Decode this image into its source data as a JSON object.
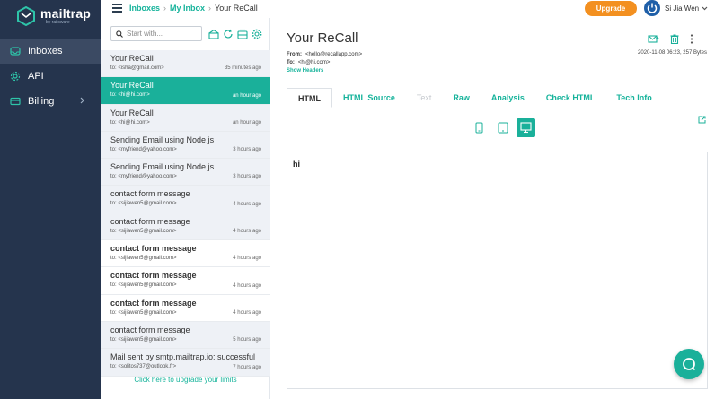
{
  "app": {
    "name": "mailtrap",
    "byline": "by railsware"
  },
  "nav": [
    {
      "label": "Inboxes"
    },
    {
      "label": "API"
    },
    {
      "label": "Billing"
    }
  ],
  "breadcrumb": {
    "level1": "Inboxes",
    "level2": "My Inbox",
    "current": "Your ReCall",
    "separator": "›"
  },
  "header": {
    "upgrade_label": "Upgrade",
    "user_name": "Si Jia Wen"
  },
  "search": {
    "placeholder": "Start with..."
  },
  "messages": [
    {
      "subject": "Your ReCall",
      "to": "to: <isha@gmail.com>",
      "time": "35 minutes ago"
    },
    {
      "subject": "Your ReCall",
      "to": "to: <hi@hi.com>",
      "time": "an hour ago"
    },
    {
      "subject": "Your ReCall",
      "to": "to: <hi@hi.com>",
      "time": "an hour ago"
    },
    {
      "subject": "Sending Email using Node.js",
      "to": "to: <myfriend@yahoo.com>",
      "time": "3 hours ago"
    },
    {
      "subject": "Sending Email using Node.js",
      "to": "to: <myfriend@yahoo.com>",
      "time": "3 hours ago"
    },
    {
      "subject": "contact form message",
      "to": "to: <sijiawen5@gmail.com>",
      "time": "4 hours ago"
    },
    {
      "subject": "contact form message",
      "to": "to: <sijiawen5@gmail.com>",
      "time": "4 hours ago"
    },
    {
      "subject": "contact form message",
      "to": "to: <sijiawen5@gmail.com>",
      "time": "4 hours ago"
    },
    {
      "subject": "contact form message",
      "to": "to: <sijiawen5@gmail.com>",
      "time": "4 hours ago"
    },
    {
      "subject": "contact form message",
      "to": "to: <sijiawen5@gmail.com>",
      "time": "4 hours ago"
    },
    {
      "subject": "contact form message",
      "to": "to: <sijiawen5@gmail.com>",
      "time": "5 hours ago"
    },
    {
      "subject": "Mail sent by smtp.mailtrap.io: successful",
      "to": "to: <solitos737@outlook.fr>",
      "time": "7 hours ago"
    }
  ],
  "upgrade_link": "Click here to upgrade your limits",
  "message": {
    "subject": "Your ReCall",
    "from_label": "From:",
    "from": "<hello@recallapp.com>",
    "to_label": "To:",
    "to": "<hi@hi.com>",
    "show_headers": "Show Headers",
    "date_size": "2020-11-08 06:23, 257 Bytes",
    "body": "hi"
  },
  "tabs": [
    {
      "label": "HTML"
    },
    {
      "label": "HTML Source"
    },
    {
      "label": "Text"
    },
    {
      "label": "Raw"
    },
    {
      "label": "Analysis"
    },
    {
      "label": "Check HTML"
    },
    {
      "label": "Tech Info"
    }
  ],
  "colors": {
    "accent": "#1ab09a",
    "sidebar": "#25344d",
    "upgrade": "#f39020"
  },
  "icons": [
    "mailtrap-logo",
    "inbox-icon",
    "api-icon",
    "billing-icon",
    "search-icon",
    "forward-icon",
    "trash-icon",
    "more-icon",
    "mobile-icon",
    "tablet-icon",
    "desktop-icon",
    "external-link-icon",
    "chat-icon"
  ]
}
